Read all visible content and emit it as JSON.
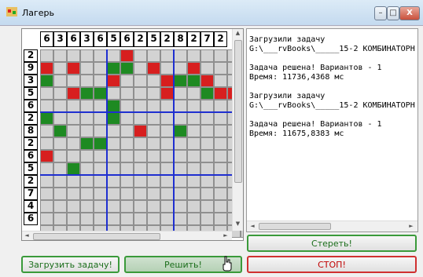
{
  "window": {
    "title": "Лагерь",
    "controls": {
      "minimize": "–",
      "maximize": "□",
      "close": "X"
    }
  },
  "puzzle": {
    "column_clues": [
      "6",
      "3",
      "6",
      "3",
      "6",
      "5",
      "6",
      "2",
      "5",
      "2",
      "8",
      "2",
      "7",
      "2"
    ],
    "row_clues": [
      "2",
      "9",
      "3",
      "5",
      "6",
      "2",
      "8",
      "2",
      "6",
      "5",
      "2",
      "7",
      "4",
      "6"
    ],
    "colors": {
      "tent": "#d71f1f",
      "tree": "#1e8a22",
      "empty": "#d3d3d3",
      "gridline": "#8f8f8f",
      "block": "#1f2fd0"
    },
    "cells": [
      "eeeeeeteeeeeeeegee",
      "teteeggeteeteeeeee",
      "geeeeteeetggteeeee",
      "eetggeeeeteegtteee",
      "eeeeegeeeeeeeeeeee",
      "geeeegeeeeeeeeeeee",
      "egeeeeeteegeeeeeee",
      "eeeggeeeeeeeeeeeee",
      "teeeeeeeeeeeeeeeee",
      "eegeeeeeeeeeeeeeee",
      "eeeeeeeeeeeeeeeeee",
      "eeeeeeeeeeeeeeeeee",
      "eeeeeeeeeeeeeeeeee",
      "eeeeeeeeeeeeeeeeee",
      "eeeeeeeeeeeeeeeeee"
    ]
  },
  "output": {
    "lines": [
      "Загрузили задачу",
      "G:\\___rvBooks\\_____15-2 КОМБИНАТОРН",
      "",
      "Задача решена! Вариантов - 1",
      "Время: 11736,4368 мс",
      "",
      "Загрузили задачу",
      "G:\\___rvBooks\\_____15-2 КОМБИНАТОРН",
      "",
      "Задача решена! Вариантов - 1",
      "Время: 11675,8383 мс"
    ]
  },
  "buttons": {
    "load": "Загрузить задачу!",
    "solve": "Решить!",
    "clear": "Стереть!",
    "stop": "СТОП!"
  },
  "scroll": {
    "up": "▲",
    "down": "▼",
    "left": "◄",
    "right": "►"
  }
}
